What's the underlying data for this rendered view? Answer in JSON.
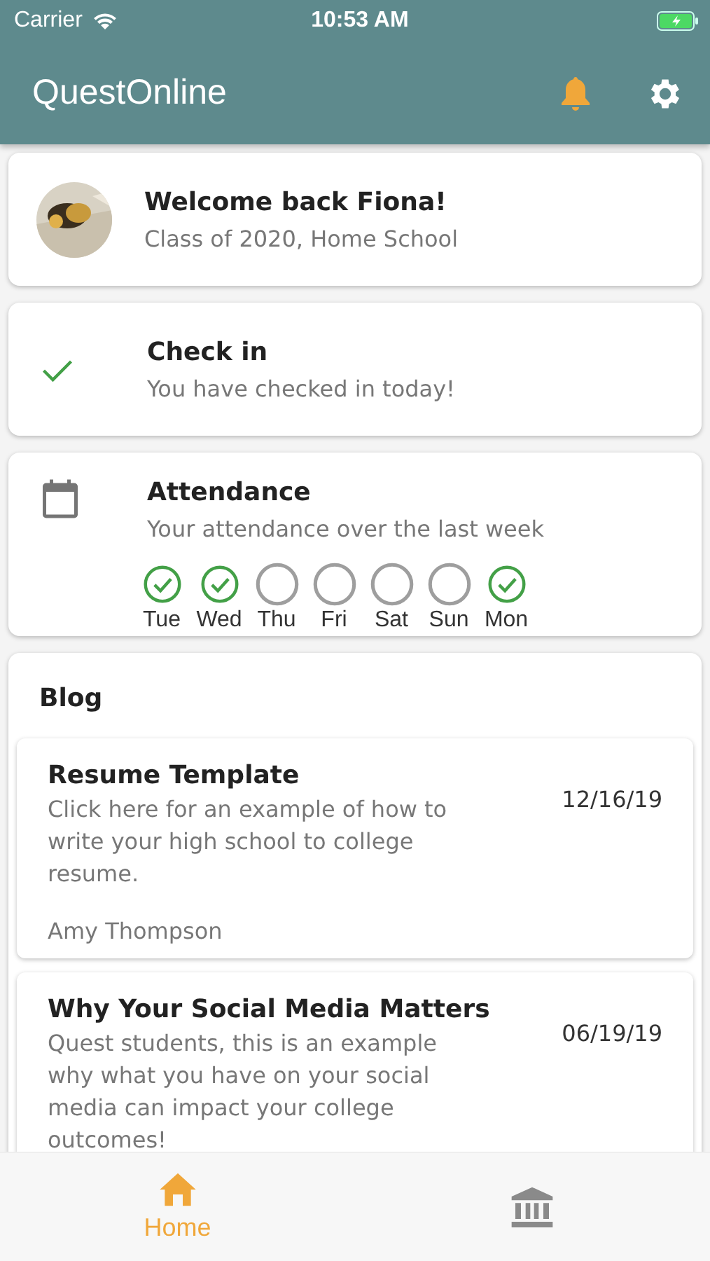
{
  "status_bar": {
    "carrier": "Carrier",
    "time": "10:53 AM"
  },
  "app_bar": {
    "title": "QuestOnline"
  },
  "welcome": {
    "title": "Welcome back Fiona!",
    "subtitle": "Class of 2020, Home School"
  },
  "check_in": {
    "title": "Check in",
    "subtitle": "You have checked in today!",
    "checked": true
  },
  "attendance": {
    "title": "Attendance",
    "subtitle": "Your attendance over the last week",
    "days": [
      {
        "label": "Tue",
        "checked": true
      },
      {
        "label": "Wed",
        "checked": true
      },
      {
        "label": "Thu",
        "checked": false
      },
      {
        "label": "Fri",
        "checked": false
      },
      {
        "label": "Sat",
        "checked": false
      },
      {
        "label": "Sun",
        "checked": false
      },
      {
        "label": "Mon",
        "checked": true
      }
    ]
  },
  "blog": {
    "title": "Blog",
    "posts": [
      {
        "title": "Resume Template",
        "summary": "Click here for an example of how to write your high school to college resume.",
        "date": "12/16/19",
        "author": "Amy Thompson"
      },
      {
        "title": "Why Your Social Media Matters",
        "summary": "Quest students, this is an example why what you have on your social media can impact your college outcomes!",
        "date": "06/19/19"
      }
    ]
  },
  "tab_bar": [
    {
      "label": "Home",
      "kind": "home",
      "selected": true
    },
    {
      "kind": "bank",
      "selected": false
    }
  ]
}
